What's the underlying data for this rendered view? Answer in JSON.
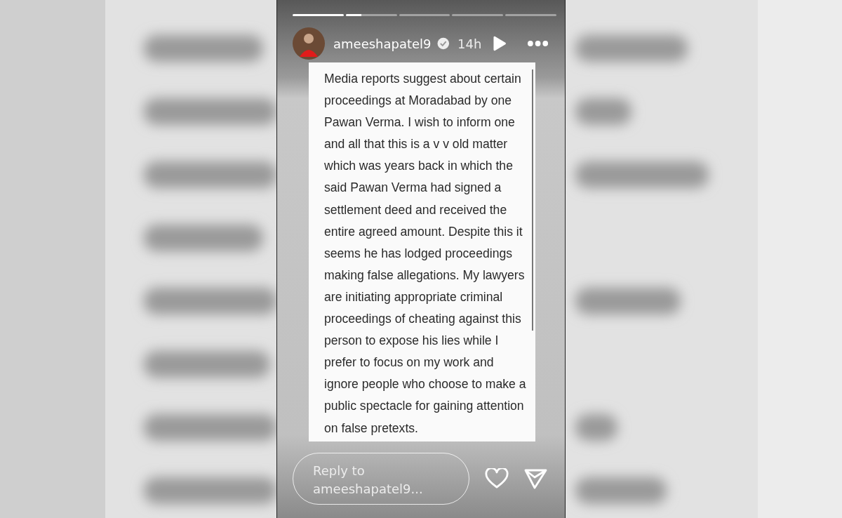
{
  "story": {
    "progress": [
      {
        "level": 1
      },
      {
        "level": 0.3
      },
      {
        "level": 0
      },
      {
        "level": 0
      },
      {
        "level": 0
      }
    ],
    "username": "ameeshapatel9",
    "verified": true,
    "time": "14h",
    "text": "Media reports suggest about certain proceedings at Moradabad by one Pawan Verma. I wish to inform one and all that this is a v v old matter which was years back in which the said Pawan Verma had signed a settlement deed and received the entire agreed amount. Despite this it seems he has lodged proceedings making false allegations. My lawyers are initiating appropriate criminal proceedings of cheating against this person to expose his lies while I prefer to focus on my work and ignore people who choose to make a public spectacle for gaining attention on false pretexts.",
    "reply": {
      "placeholder": "Reply to ameeshapatel9..."
    }
  }
}
